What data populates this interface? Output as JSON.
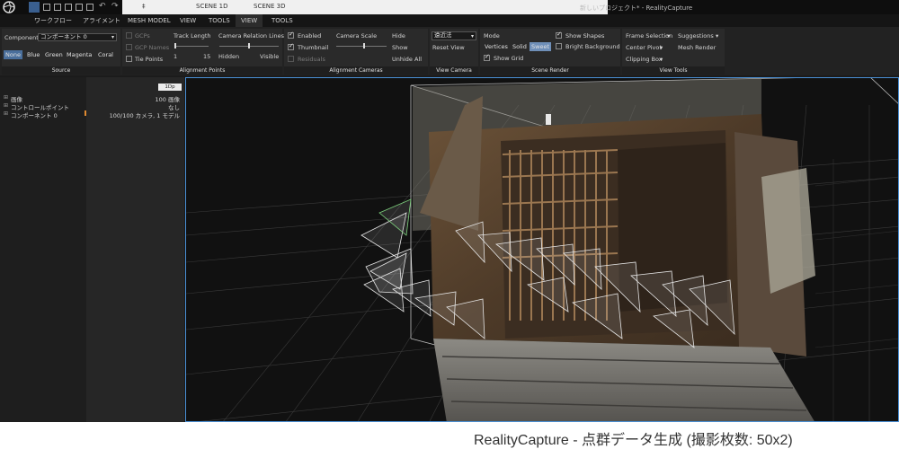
{
  "titlebar": {
    "window_title": "新しいプロジェクト* - RealityCapture",
    "doc_tab_marker": "‡",
    "layout_tabs": [
      "SCENE 1D",
      "SCENE 3D"
    ],
    "quick_icons": [
      "layout-1-icon",
      "layout-2-icon",
      "layout-3-icon",
      "layout-4-icon",
      "layout-5-icon",
      "layout-6-icon",
      "undo-icon",
      "redo-icon"
    ]
  },
  "menu": {
    "items": [
      "ワークフロー",
      "アライメント",
      "MESH MODEL",
      "VIEW",
      "TOOLS",
      "VIEW",
      "TOOLS"
    ],
    "active_index": 5
  },
  "ribbon": {
    "source": {
      "title": "Source",
      "component_label": "Component",
      "component_value": "コンポーネント 0",
      "colors": [
        "None",
        "Blue",
        "Green",
        "Magenta",
        "Coral"
      ],
      "selected_color": "None"
    },
    "alignment_points": {
      "title": "Alignment Points",
      "gcps": "GCPs",
      "gcp_names": "GCP Names",
      "tie_points": "Tie Points",
      "track_length": "Track Length",
      "track_min": "1",
      "track_max": "15",
      "camera_relation_lines": "Camera Relation Lines",
      "hidden": "Hidden",
      "visible": "Visible"
    },
    "alignment_cameras": {
      "title": "Alignment Cameras",
      "enabled": "Enabled",
      "thumbnail": "Thumbnail",
      "residuals": "Residuals",
      "camera_scale": "Camera Scale",
      "hide": "Hide",
      "show": "Show",
      "unhide_all": "Unhide All"
    },
    "view_camera": {
      "title": "View Camera",
      "projection_value": "遠近法",
      "reset_view": "Reset View"
    },
    "scene_render": {
      "title": "Scene Render",
      "mode": "Mode",
      "modes": [
        "Vertices",
        "Solid",
        "Sweet"
      ],
      "selected_mode": "Sweet",
      "show_grid": "Show Grid",
      "show_shapes": "Show Shapes",
      "bright_background": "Bright Background"
    },
    "view_tools": {
      "title": "View Tools",
      "frame_selection": "Frame Selection",
      "suggestions": "Suggestions",
      "center_pivot": "Center Pivot",
      "mesh_render": "Mesh Render",
      "clipping_box": "Clipping Box"
    }
  },
  "tree": {
    "zoom_badge": "1Dp",
    "rows": [
      {
        "name": "画像",
        "value": "100 画像"
      },
      {
        "name": "コントロールポイント",
        "value": "なし"
      },
      {
        "name": "コンポーネント 0",
        "value": "100/100 カメラ, 1 モデル"
      }
    ]
  },
  "caption": "RealityCapture - 点群データ生成 (撮影枚数: 50x2)",
  "colors": {
    "accent": "#4a90d6",
    "selected": "#4a6f9c",
    "sweet": "#6f8fb8",
    "background": "#1b1b1b"
  }
}
